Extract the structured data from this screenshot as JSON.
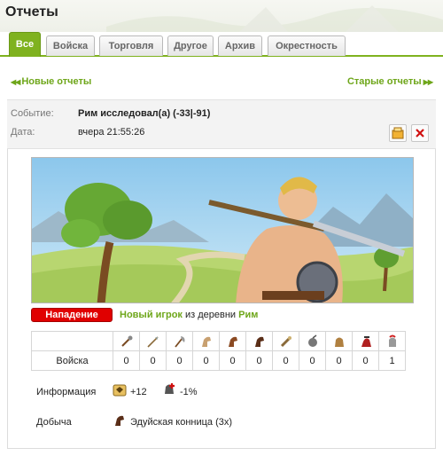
{
  "title": "Отчеты",
  "tabs": [
    {
      "label": "Все",
      "active": true
    },
    {
      "label": "Войска",
      "active": false
    },
    {
      "label": "Торговля",
      "active": false
    },
    {
      "label": "Другое",
      "active": false
    },
    {
      "label": "Архив",
      "active": false
    },
    {
      "label": "Окрестность",
      "active": false
    }
  ],
  "nav": {
    "newer": "Новые отчеты",
    "older": "Старые отчеты"
  },
  "report": {
    "event_label": "Событие:",
    "event_value": "Рим исследовал(а) (-33|-91)",
    "date_label": "Дата:",
    "date_value": "вчера 21:55:26",
    "attack_badge": "Нападение",
    "attacker_player": "Новый игрок",
    "attacker_from": "из деревни",
    "attacker_village": "Рим",
    "troops_label": "Войска",
    "unit_icons": [
      "mace-icon",
      "spear-icon",
      "axe-icon",
      "scout-horse-icon",
      "paladin-icon",
      "teutonic-knight-icon",
      "ram-icon",
      "catapult-icon",
      "chief-icon",
      "settler-icon",
      "hero-icon"
    ],
    "troop_counts": [
      "0",
      "0",
      "0",
      "0",
      "0",
      "0",
      "0",
      "0",
      "0",
      "0",
      "1"
    ],
    "info_label": "Информация",
    "info_exp": "+12",
    "info_health": "-1%",
    "loot_label": "Добыча",
    "loot_value": "Эдуйская конница (3x)"
  },
  "colors": {
    "accent": "#7fb21f",
    "link": "#6ea61a",
    "attack": "#e00000"
  }
}
